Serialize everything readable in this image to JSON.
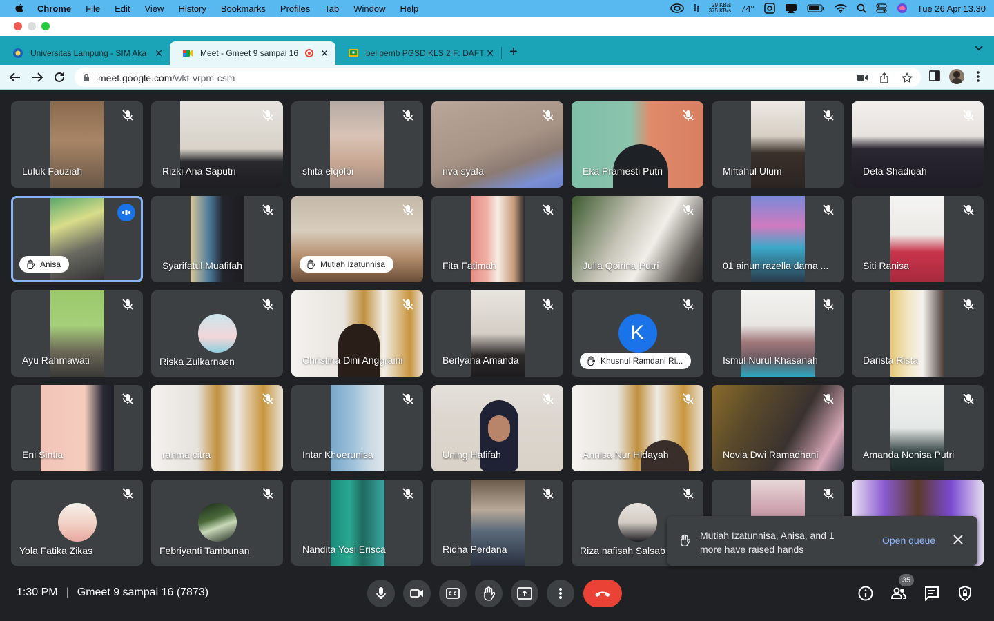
{
  "menubar": {
    "app_name": "Chrome",
    "menus": [
      "File",
      "Edit",
      "View",
      "History",
      "Bookmarks",
      "Profiles",
      "Tab",
      "Window",
      "Help"
    ],
    "net_up": "29 KB/s",
    "net_down": "375 KB/s",
    "temperature": "74°",
    "datetime": "Tue 26 Apr  13.30"
  },
  "tabs": [
    {
      "title": "Universitas Lampung - SIM Aka",
      "icon": "unila-icon"
    },
    {
      "title": "Meet - Gmeet 9 sampai 16",
      "icon": "meet-icon",
      "active": true
    },
    {
      "title": "bel pemb PGSD KLS 2 F: DAFT",
      "icon": "classroom-icon"
    }
  ],
  "address_bar": {
    "domain": "meet.google.com",
    "path": "/wkt-vrpm-csm"
  },
  "participants": [
    {
      "name": "Luluk Fauziah"
    },
    {
      "name": "Rizki Ana Saputri"
    },
    {
      "name": "shita elqolbi"
    },
    {
      "name": "riva syafa"
    },
    {
      "name": "Eka Pramesti Putri"
    },
    {
      "name": "Miftahul Ulum"
    },
    {
      "name": "Deta Shadiqah"
    },
    {
      "name": "Anisa",
      "hand_raised": true,
      "speaking": true
    },
    {
      "name": "Syarifatul Muafifah"
    },
    {
      "name": "Mutiah Izatunnisa",
      "hand_raised": true
    },
    {
      "name": "Fita Fatimah"
    },
    {
      "name": "Julia Qoirina Putri"
    },
    {
      "name": "01 ainun razella dama ..."
    },
    {
      "name": "Siti Ranisa"
    },
    {
      "name": "Ayu Rahmawati"
    },
    {
      "name": "Riska Zulkarnaen"
    },
    {
      "name": "Christina Dini Anggraini"
    },
    {
      "name": "Berlyana Amanda"
    },
    {
      "name": "Khusnul Ramdani Ri...",
      "hand_raised": true,
      "avatar_letter": "K"
    },
    {
      "name": "Ismul Nurul Khasanah"
    },
    {
      "name": "Darista Rista"
    },
    {
      "name": "Eni Sintia"
    },
    {
      "name": "rahma citra"
    },
    {
      "name": "Intar Khoerunisa"
    },
    {
      "name": "Uning Hafifah"
    },
    {
      "name": "Annisa Nur Hidayah"
    },
    {
      "name": "Novia Dwi Ramadhani"
    },
    {
      "name": "Amanda Nonisa Putri"
    },
    {
      "name": "Yola Fatika Zikas"
    },
    {
      "name": "Febriyanti Tambunan"
    },
    {
      "name": "Nandita Yosi Erisca"
    },
    {
      "name": "Ridha Perdana"
    },
    {
      "name": "Riza nafisah Salsab"
    },
    {
      "name": ""
    },
    {
      "name": ""
    }
  ],
  "toast": {
    "message": "Mutiah Izatunnisa, Anisa, and 1 more have raised hands",
    "action": "Open queue"
  },
  "meeting": {
    "time": "1:30 PM",
    "title": "Gmeet 9 sampai 16 (7873)",
    "participant_count": "35"
  },
  "colors": {
    "menubar": "#58b8f0",
    "tabstrip": "#1ba4b7",
    "meet_bg": "#202124",
    "tile_bg": "#3c4043",
    "end_call": "#ea4335",
    "accent": "#8ab4f8"
  }
}
